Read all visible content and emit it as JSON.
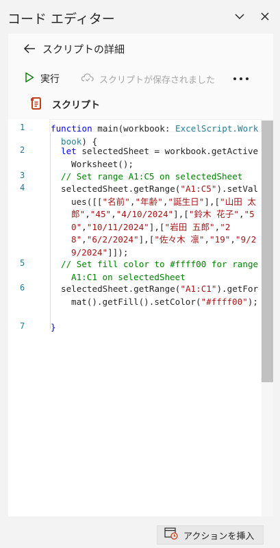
{
  "pane": {
    "title": "コード エディター"
  },
  "details": {
    "back_title": "スクリプトの詳細"
  },
  "toolbar": {
    "run_label": "実行",
    "save_status": "スクリプトが保存されました"
  },
  "script": {
    "section_title": "スクリプト"
  },
  "editor": {
    "lines": [
      {
        "number": "1",
        "indent": 0,
        "tokens": [
          {
            "t": "kw",
            "v": "function"
          },
          {
            "t": "",
            "v": " main(workbook: "
          },
          {
            "t": "ty",
            "v": "ExcelScript."
          },
          {
            "t": "ty",
            "v": "Workbook"
          },
          {
            "t": "",
            "v": ") {"
          }
        ]
      },
      {
        "number": "2",
        "indent": 1,
        "tokens": [
          {
            "t": "kw",
            "v": "let"
          },
          {
            "t": "",
            "v": " selectedSheet = workbook.getActiveWorksheet();"
          }
        ]
      },
      {
        "number": "3",
        "indent": 1,
        "tokens": [
          {
            "t": "cm",
            "v": "// Set range A1:C5 on selectedSheet"
          }
        ]
      },
      {
        "number": "4",
        "indent": 1,
        "tokens": [
          {
            "t": "",
            "v": "selectedSheet.getRange("
          },
          {
            "t": "st",
            "v": "\"A1:C5\""
          },
          {
            "t": "",
            "v": ").setValues([["
          },
          {
            "t": "st",
            "v": "\"名前\""
          },
          {
            "t": "",
            "v": ","
          },
          {
            "t": "st",
            "v": "\"年齢\""
          },
          {
            "t": "",
            "v": ","
          },
          {
            "t": "st",
            "v": "\"誕生日\""
          },
          {
            "t": "",
            "v": "],["
          },
          {
            "t": "st",
            "v": "\"山田 太郎\""
          },
          {
            "t": "",
            "v": ","
          },
          {
            "t": "st",
            "v": "\"45\""
          },
          {
            "t": "",
            "v": ","
          },
          {
            "t": "st",
            "v": "\"4/10/2024\""
          },
          {
            "t": "",
            "v": "],["
          },
          {
            "t": "st",
            "v": "\"鈴木 花子\""
          },
          {
            "t": "",
            "v": ","
          },
          {
            "t": "st",
            "v": "\"50\""
          },
          {
            "t": "",
            "v": ","
          },
          {
            "t": "st",
            "v": "\"10/11/2024\""
          },
          {
            "t": "",
            "v": "],["
          },
          {
            "t": "st",
            "v": "\"岩田 五郎\""
          },
          {
            "t": "",
            "v": ","
          },
          {
            "t": "st",
            "v": "\"28\""
          },
          {
            "t": "",
            "v": ","
          },
          {
            "t": "st",
            "v": "\"6/2/2024\""
          },
          {
            "t": "",
            "v": "],["
          },
          {
            "t": "st",
            "v": "\"佐々木 凛\""
          },
          {
            "t": "",
            "v": ","
          },
          {
            "t": "st",
            "v": "\"19\""
          },
          {
            "t": "",
            "v": ","
          },
          {
            "t": "st",
            "v": "\"9/29/2024\""
          },
          {
            "t": "",
            "v": "]]);"
          }
        ]
      },
      {
        "number": "5",
        "indent": 1,
        "tokens": [
          {
            "t": "cm",
            "v": "// Set fill color to #ffff00 for range A1:C1 on selectedSheet"
          }
        ]
      },
      {
        "number": "6",
        "indent": 1,
        "tokens": [
          {
            "t": "",
            "v": "selectedSheet.getRange("
          },
          {
            "t": "st",
            "v": "\"A1:C1\""
          },
          {
            "t": "",
            "v": ").getFormat().getFill().setColor("
          },
          {
            "t": "st",
            "v": "\"#ffff00\""
          },
          {
            "t": "",
            "v": ");"
          }
        ]
      },
      {
        "number": "7",
        "indent": 0,
        "tokens": [
          {
            "t": "kw",
            "v": "}"
          }
        ]
      }
    ]
  },
  "footer": {
    "insert_action_label": "アクションを挿入"
  },
  "icons": {
    "chevron": "chevron-down-icon",
    "close": "close-icon",
    "back": "back-arrow-icon",
    "run": "play-icon",
    "saved": "cloud-check-icon",
    "more": "more-icon",
    "script": "script-file-icon",
    "insert": "insert-action-icon"
  },
  "colors": {
    "accent_green": "#107c10",
    "script_icon_red": "#c43e1c",
    "keyword": "#0000ff",
    "type": "#267f99",
    "comment": "#008000",
    "string": "#a31515",
    "line_number": "#237893"
  }
}
